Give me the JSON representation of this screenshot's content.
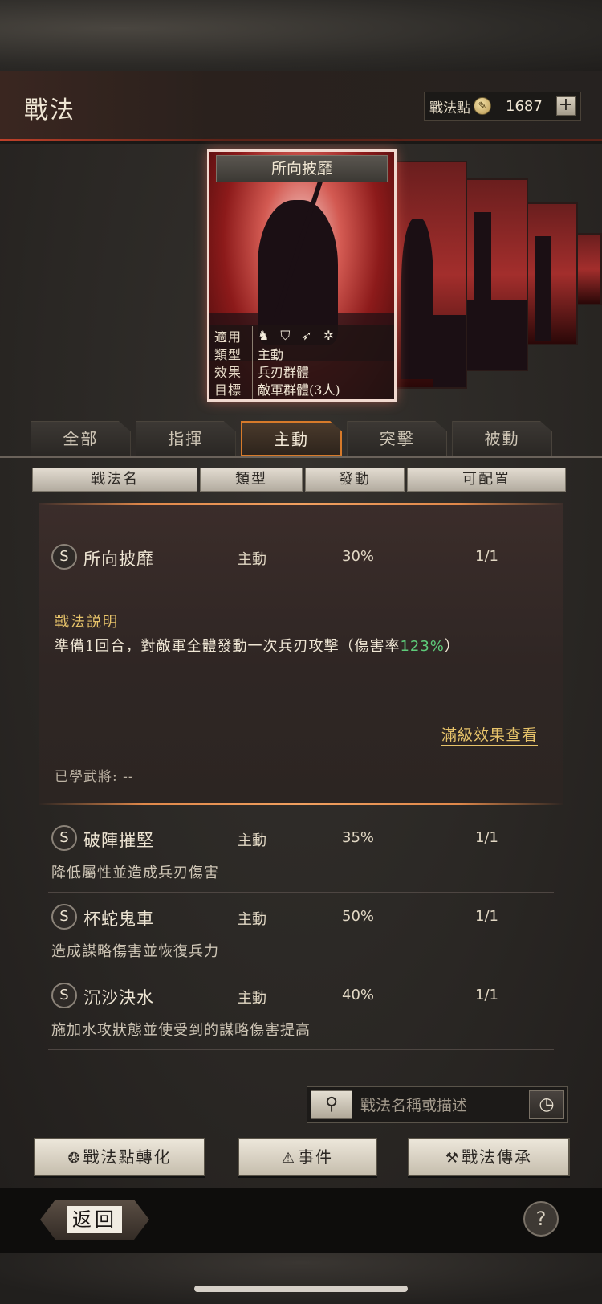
{
  "header": {
    "title": "戰法",
    "points_label": "戰法點",
    "points_value": "1687",
    "plus_label": "+"
  },
  "featured_card": {
    "name": "所向披靡",
    "info": [
      {
        "label": "適用",
        "value": ""
      },
      {
        "label": "類型",
        "value": "主動"
      },
      {
        "label": "效果",
        "value": "兵刃群體"
      },
      {
        "label": "目標",
        "value": "敵軍群體(3人)"
      }
    ],
    "troop_icons": [
      "cavalry-icon",
      "shield-icon",
      "spear-icon",
      "chariot-icon"
    ]
  },
  "tabs": [
    "全部",
    "指揮",
    "主動",
    "突擊",
    "被動"
  ],
  "active_tab": "主動",
  "columns": [
    "戰法名",
    "類型",
    "發動",
    "可配置"
  ],
  "expanded_skill": {
    "grade": "S",
    "name": "所向披靡",
    "type": "主動",
    "rate": "30%",
    "slots": "1/1",
    "desc_title": "戰法説明",
    "desc_prefix": "準備1回合，對敵軍全體發動一次兵刃攻擊（傷害率",
    "desc_highlight": "123%",
    "desc_suffix": "）",
    "full_effect_link": "滿級效果查看",
    "learned": "已學武將: --"
  },
  "skills": [
    {
      "grade": "S",
      "name": "破陣摧堅",
      "type": "主動",
      "rate": "35%",
      "slots": "1/1",
      "desc": "降低屬性並造成兵刃傷害"
    },
    {
      "grade": "S",
      "name": "杯蛇鬼車",
      "type": "主動",
      "rate": "50%",
      "slots": "1/1",
      "desc": "造成謀略傷害並恢復兵力"
    },
    {
      "grade": "S",
      "name": "沉沙決水",
      "type": "主動",
      "rate": "40%",
      "slots": "1/1",
      "desc": "施加水攻狀態並使受到的謀略傷害提高"
    }
  ],
  "search": {
    "placeholder": "戰法名稱或描述"
  },
  "actions": {
    "convert": "戰法點轉化",
    "events": "事件",
    "inherit": "戰法傳承"
  },
  "footer": {
    "back": "返回",
    "help": "?"
  }
}
